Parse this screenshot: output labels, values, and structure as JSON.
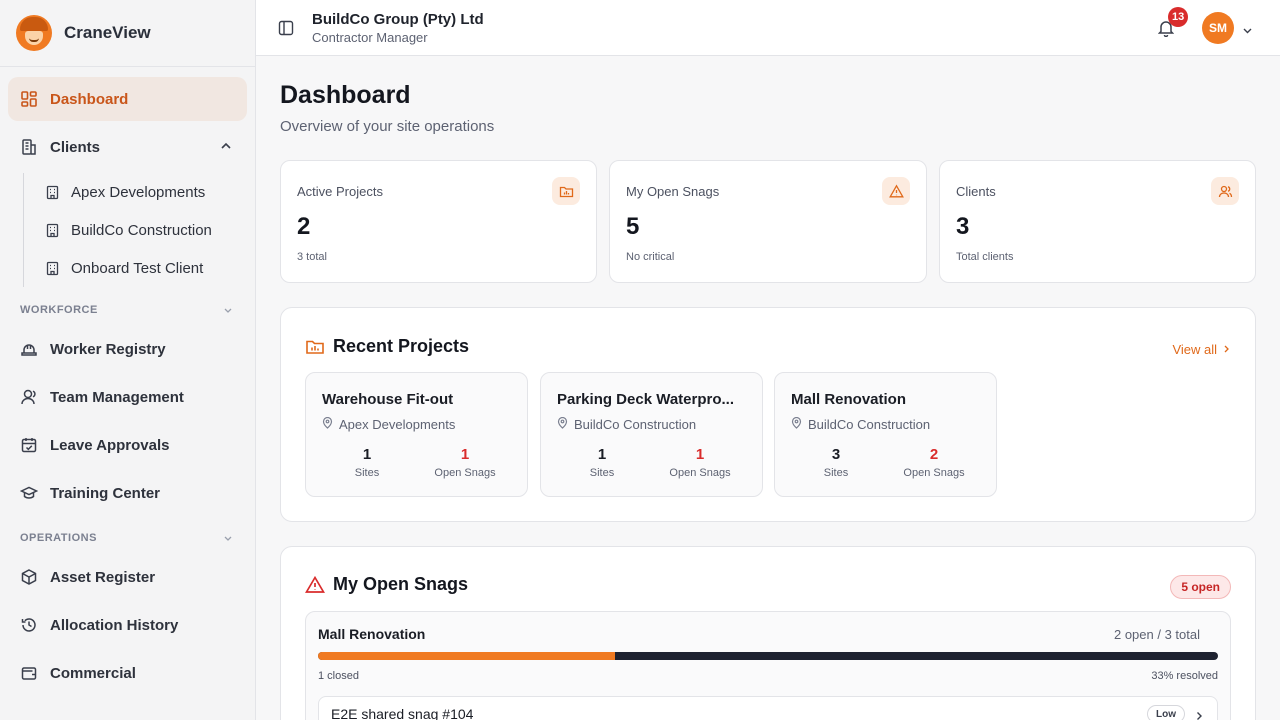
{
  "app": {
    "name": "CraneView"
  },
  "sidebar": {
    "items": [
      {
        "label": "Dashboard"
      },
      {
        "label": "Clients"
      }
    ],
    "clients": [
      "Apex Developments",
      "BuildCo Construction",
      "Onboard Test Client"
    ],
    "sections": [
      {
        "label": "WORKFORCE",
        "items": [
          "Worker Registry",
          "Team Management",
          "Leave Approvals",
          "Training Center"
        ]
      },
      {
        "label": "OPERATIONS",
        "items": [
          "Asset Register",
          "Allocation History",
          "Commercial"
        ]
      }
    ]
  },
  "header": {
    "org_name": "BuildCo Group (Pty) Ltd",
    "role": "Contractor Manager",
    "notification_count": "13",
    "avatar_initials": "SM"
  },
  "page": {
    "title": "Dashboard",
    "subtitle": "Overview of your site operations"
  },
  "stats": [
    {
      "label": "Active Projects",
      "value": "2",
      "sub": "3 total",
      "icon": "folder-chart-icon"
    },
    {
      "label": "My Open Snags",
      "value": "5",
      "sub": "No critical",
      "icon": "warning-triangle-icon"
    },
    {
      "label": "Clients",
      "value": "3",
      "sub": "Total clients",
      "icon": "users-icon"
    }
  ],
  "recent_projects": {
    "title": "Recent Projects",
    "view_all": "View all",
    "projects": [
      {
        "name": "Warehouse Fit-out",
        "client": "Apex Developments",
        "sites": "1",
        "open_snags": "1",
        "sites_label": "Sites",
        "snags_label": "Open Snags"
      },
      {
        "name": "Parking Deck Waterpro...",
        "client": "BuildCo Construction",
        "sites": "1",
        "open_snags": "1",
        "sites_label": "Sites",
        "snags_label": "Open Snags"
      },
      {
        "name": "Mall Renovation",
        "client": "BuildCo Construction",
        "sites": "3",
        "open_snags": "2",
        "sites_label": "Sites",
        "snags_label": "Open Snags"
      }
    ]
  },
  "open_snags": {
    "title": "My Open Snags",
    "badge": "5 open",
    "group": {
      "project": "Mall Renovation",
      "count_text": "2 open / 3 total",
      "progress_resolved": 0.33,
      "closed_text": "1 closed",
      "resolved_text": "33% resolved",
      "first_snag": {
        "title": "E2E shared snag #104",
        "severity": "Low"
      }
    }
  },
  "colors": {
    "accent": "#f07a22",
    "danger": "#d92c2c",
    "dark_bar": "#1e2230"
  }
}
